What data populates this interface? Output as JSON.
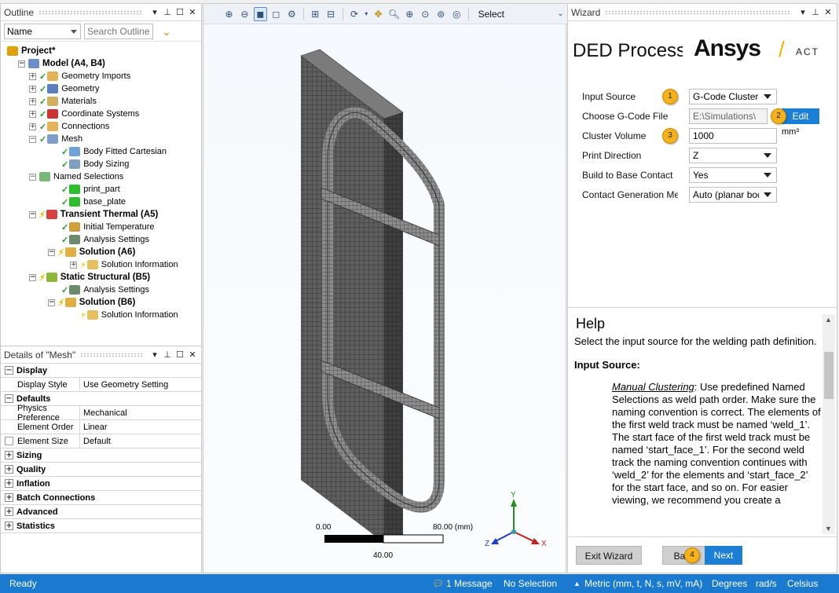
{
  "outline": {
    "title": "Outline",
    "filter_label": "Name",
    "search_placeholder": "Search Outline",
    "tree": [
      {
        "label": "Project*",
        "icon": "project-icon"
      },
      {
        "label": "Model (A4, B4)",
        "icon": "model-icon"
      },
      {
        "label": "Geometry Imports",
        "icon": "geometry-imports-icon"
      },
      {
        "label": "Geometry",
        "icon": "geometry-icon"
      },
      {
        "label": "Materials",
        "icon": "materials-icon"
      },
      {
        "label": "Coordinate Systems",
        "icon": "coordinate-systems-icon"
      },
      {
        "label": "Connections",
        "icon": "connections-icon"
      },
      {
        "label": "Mesh",
        "icon": "mesh-icon"
      },
      {
        "label": "Body Fitted Cartesian",
        "icon": "mesh-method-icon"
      },
      {
        "label": "Body Sizing",
        "icon": "body-sizing-icon"
      },
      {
        "label": "Named Selections",
        "icon": "named-selections-icon"
      },
      {
        "label": "print_part",
        "icon": "named-selection-item-icon"
      },
      {
        "label": "base_plate",
        "icon": "named-selection-item-icon"
      },
      {
        "label": "Transient Thermal (A5)",
        "icon": "transient-thermal-icon"
      },
      {
        "label": "Initial Temperature",
        "icon": "initial-temperature-icon"
      },
      {
        "label": "Analysis Settings",
        "icon": "analysis-settings-icon"
      },
      {
        "label": "Solution (A6)",
        "icon": "solution-icon"
      },
      {
        "label": "Solution Information",
        "icon": "solution-information-icon"
      },
      {
        "label": "Static Structural (B5)",
        "icon": "static-structural-icon"
      },
      {
        "label": "Analysis Settings",
        "icon": "analysis-settings-icon"
      },
      {
        "label": "Solution (B6)",
        "icon": "solution-icon"
      },
      {
        "label": "Solution Information",
        "icon": "solution-information-icon"
      }
    ]
  },
  "details": {
    "title": "Details of \"Mesh\"",
    "rows": [
      {
        "category": "Display"
      },
      {
        "key": "Display Style",
        "value": "Use Geometry Setting"
      },
      {
        "category": "Defaults"
      },
      {
        "key": "Physics Preference",
        "value": "Mechanical"
      },
      {
        "key": "Element Order",
        "value": "Linear"
      },
      {
        "key": "Element Size",
        "value": "Default"
      },
      {
        "category": "Sizing"
      },
      {
        "category": "Quality"
      },
      {
        "category": "Inflation"
      },
      {
        "category": "Batch Connections"
      },
      {
        "category": "Advanced"
      },
      {
        "category": "Statistics"
      }
    ]
  },
  "viewport": {
    "select_label": "Select",
    "scale": {
      "left": "0.00",
      "right": "80.00 (mm)",
      "mid": "40.00"
    },
    "axes": {
      "x": "X",
      "y": "Y",
      "z": "Z"
    }
  },
  "wizard": {
    "title": "Wizard",
    "app_title": "DED Process",
    "logo_text": "Ansys",
    "logo_suffix": "ACT",
    "fields": [
      {
        "label": "Input Source",
        "value": "G-Code Clusters",
        "type": "select",
        "badge": "1"
      },
      {
        "label": "Choose G-Code File",
        "value": "E:\\Simulations\\",
        "type": "file",
        "badge": "2",
        "button": "Edit"
      },
      {
        "label": "Cluster Volume",
        "value": "1000",
        "type": "text",
        "badge": "3",
        "unit": "mm³"
      },
      {
        "label": "Print Direction",
        "value": "Z",
        "type": "select"
      },
      {
        "label": "Build to Base Contact",
        "value": "Yes",
        "type": "select"
      },
      {
        "label": "Contact Generation Method",
        "value": "Auto (planar bodies)",
        "type": "select"
      }
    ],
    "help": {
      "title": "Help",
      "intro": "Select the input source for the welding path definition.",
      "section": "Input Source:",
      "term": "Manual Clustering",
      "body": ": Use predefined Named Selections as weld path order. Make sure the naming convention is correct. The elements of the first weld track must be named ‘weld_1’. The start face of the first weld track must be named ‘start_face_1’. For the second weld track the naming convention continues with ‘weld_2’ for the elements and ‘start_face_2’ for the start face, and so on. For easier viewing, we recommend you create a"
    },
    "buttons": {
      "exit": "Exit Wizard",
      "back": "Back",
      "next": "Next",
      "next_badge": "4"
    }
  },
  "statusbar": {
    "ready": "Ready",
    "messages": "1 Message",
    "selection": "No Selection",
    "units": "Metric (mm, t, N, s, mV, mA)",
    "angle": "Degrees",
    "rate": "rad/s",
    "temp": "Celsius"
  },
  "colors": {
    "accent": "#1b7fd6",
    "badge": "#f5b21d",
    "statusbar": "#1a7ad0"
  }
}
